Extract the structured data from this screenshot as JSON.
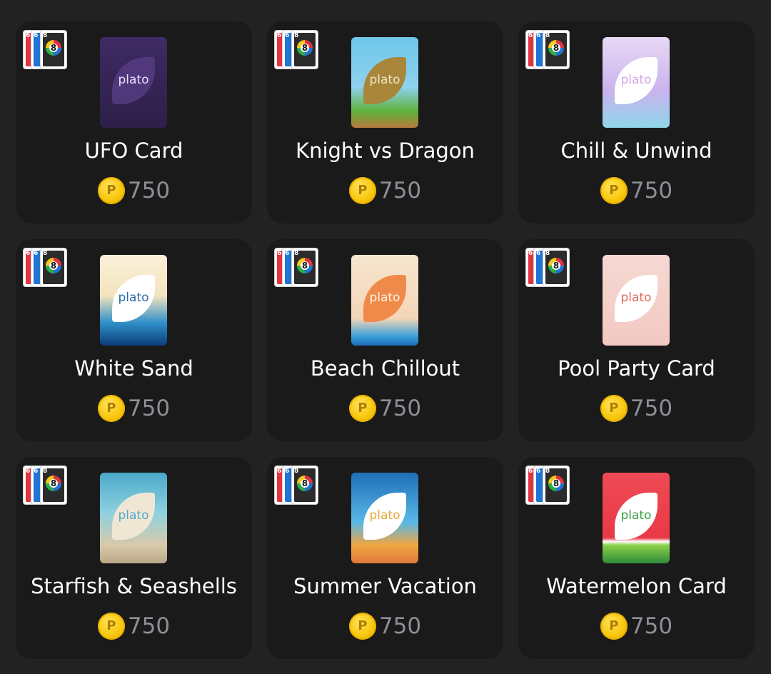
{
  "currency_symbol": "P",
  "card_brand": "plato",
  "badge": {
    "left_card_number": "6",
    "middle_card_number": "6",
    "front_card_number": "8"
  },
  "items": [
    {
      "title": "UFO Card",
      "price": "750",
      "theme": "ufo"
    },
    {
      "title": "Knight vs Dragon",
      "price": "750",
      "theme": "knight"
    },
    {
      "title": "Chill & Unwind",
      "price": "750",
      "theme": "chill"
    },
    {
      "title": "White Sand",
      "price": "750",
      "theme": "white"
    },
    {
      "title": "Beach Chillout",
      "price": "750",
      "theme": "beach"
    },
    {
      "title": "Pool Party Card",
      "price": "750",
      "theme": "pool"
    },
    {
      "title": "Starfish & Seashells",
      "price": "750",
      "theme": "star"
    },
    {
      "title": "Summer Vacation",
      "price": "750",
      "theme": "summer"
    },
    {
      "title": "Watermelon Card",
      "price": "750",
      "theme": "water"
    }
  ],
  "colors": {
    "background": "#222222",
    "tile": "#1a1a1a",
    "title_text": "#ffffff",
    "price_text": "#8c8f96",
    "coin": "#f9c80e"
  }
}
